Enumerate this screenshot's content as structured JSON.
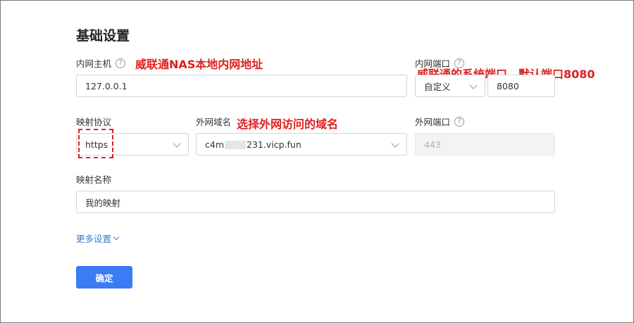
{
  "form": {
    "title": "基础设置",
    "lan_host": {
      "label": "内网主机",
      "value": "127.0.0.1"
    },
    "lan_port": {
      "label": "内网端口",
      "mode": "自定义",
      "value": "8080"
    },
    "protocol": {
      "label": "映射协议",
      "value": "https"
    },
    "domain": {
      "label": "外网域名",
      "value_prefix": "c4m",
      "value_suffix": "231.vicp.fun"
    },
    "wan_port": {
      "label": "外网端口",
      "value": "443"
    },
    "mapping_name": {
      "label": "映射名称",
      "value": "我的映射"
    },
    "more_settings": "更多设置",
    "confirm": "确定"
  },
  "annotations": {
    "lan_host_note": "威联通NAS本地内网地址",
    "lan_port_note": "威联通的系统端口，默认端口8080",
    "domain_note": "选择外网访问的域名"
  },
  "colors": {
    "annotation": "#e0201d",
    "primary": "#3b7cf6",
    "link": "#3a7bd5"
  }
}
